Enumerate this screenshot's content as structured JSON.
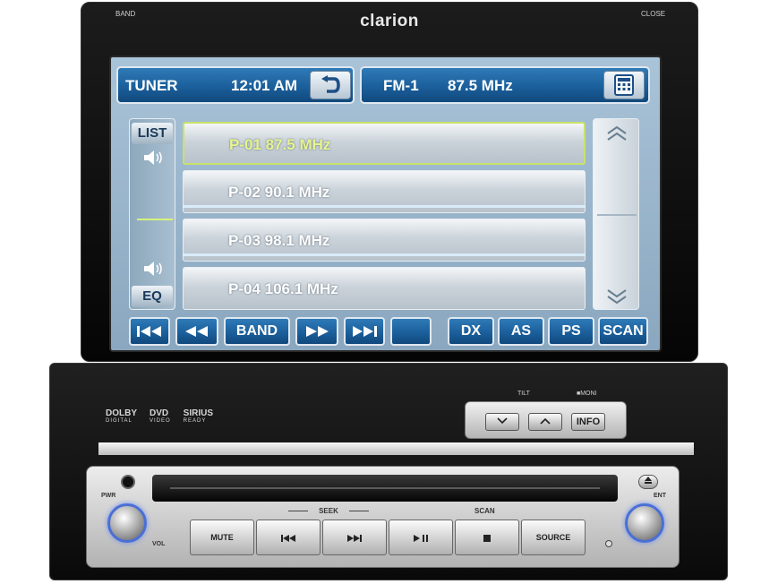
{
  "device": {
    "brand": "clarion",
    "band_label": "BAND",
    "close_label": "CLOSE"
  },
  "screen": {
    "status": {
      "source": "TUNER",
      "time": "12:01 AM",
      "band": "FM-1",
      "frequency": "87.5 MHz",
      "back_icon": "return-arrow-icon",
      "keypad_icon": "keypad-icon"
    },
    "side": {
      "list_label": "LIST",
      "eq_label": "EQ",
      "speaker_icon": "speaker-icon"
    },
    "presets": [
      {
        "label": "P-01 87.5 MHz",
        "active": true
      },
      {
        "label": "P-02 90.1 MHz",
        "active": false
      },
      {
        "label": "P-03 98.1 MHz",
        "active": false
      },
      {
        "label": "P-04 106.1 MHz",
        "active": false
      }
    ],
    "controls": {
      "band_button": "BAND",
      "dx_button": "DX",
      "as_button": "AS",
      "ps_button": "PS",
      "scan_button": "SCAN"
    },
    "accent_color": "#1b5f9b",
    "active_color": "#e6f58e"
  },
  "chassis": {
    "logos": {
      "dolby": "DOLBY",
      "dolby_sub": "DIGITAL",
      "dvd": "DVD",
      "dvd_sub": "VIDEO",
      "sirius": "SIRIUS",
      "sirius_sub": "READY"
    },
    "tilt_label": "TILT",
    "moni_label": "■MONI",
    "info_button": "INFO",
    "pwr_label": "PWR",
    "vol_label": "VOL",
    "ent_label": "ENT",
    "seek_label": "SEEK",
    "scan_label": "SCAN",
    "buttons": {
      "mute": "MUTE",
      "source": "SOURCE"
    },
    "knob_ring_color": "#4a6fd6"
  }
}
